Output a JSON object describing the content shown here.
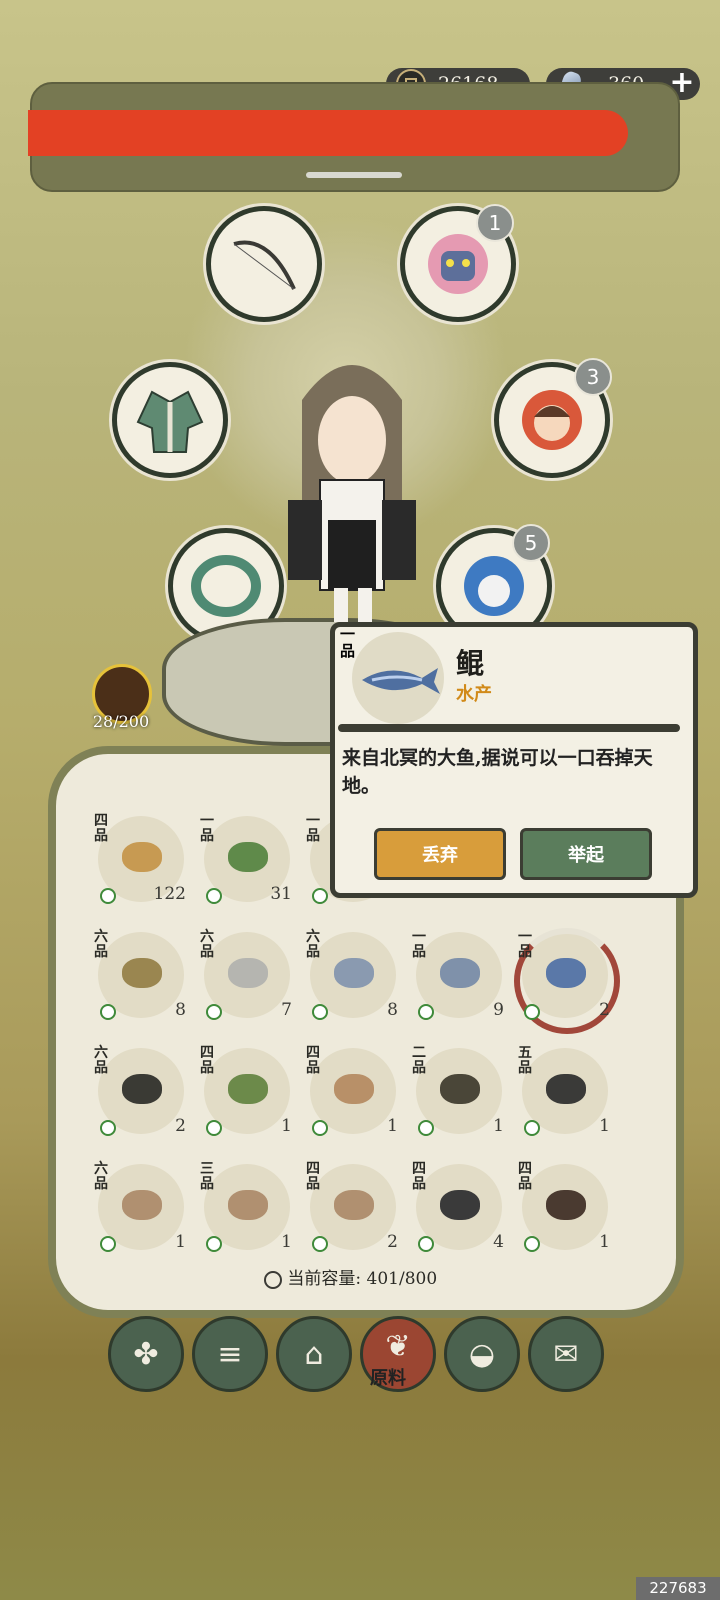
{
  "currency": {
    "coins": "26168",
    "gems": "360"
  },
  "equipment": {
    "slots": [
      {
        "name": "bow-icon"
      },
      {
        "name": "demon-mask-icon",
        "badge": "1"
      },
      {
        "name": "robe-icon"
      },
      {
        "name": "face-icon",
        "badge": "3"
      },
      {
        "name": "jade-ring-icon"
      },
      {
        "name": "spirit-icon",
        "badge": "5"
      }
    ]
  },
  "companion": {
    "count": "28/200"
  },
  "tooltip": {
    "grade": "一品",
    "name": "鲲",
    "category": "水产",
    "description": "来自北冥的大鱼,据说可以一口吞掉天地。",
    "discard_label": "丢弃",
    "lift_label": "举起"
  },
  "inventory": {
    "rows": [
      [
        {
          "g": "四品",
          "c": "122"
        },
        {
          "g": "一品",
          "c": "31"
        },
        {
          "g": "一品",
          "c": ""
        },
        {
          "g": "",
          "c": ""
        },
        {
          "g": "",
          "c": ""
        }
      ],
      [
        {
          "g": "六品",
          "c": "8"
        },
        {
          "g": "六品",
          "c": "7"
        },
        {
          "g": "六品",
          "c": "8"
        },
        {
          "g": "一品",
          "c": "9"
        },
        {
          "g": "一品",
          "c": "2"
        }
      ],
      [
        {
          "g": "六品",
          "c": "2"
        },
        {
          "g": "四品",
          "c": "1"
        },
        {
          "g": "四品",
          "c": "1"
        },
        {
          "g": "二品",
          "c": "1"
        },
        {
          "g": "五品",
          "c": "1"
        }
      ],
      [
        {
          "g": "六品",
          "c": "1"
        },
        {
          "g": "三品",
          "c": "1"
        },
        {
          "g": "四品",
          "c": "2"
        },
        {
          "g": "四品",
          "c": "4"
        },
        {
          "g": "四品",
          "c": "1"
        }
      ]
    ],
    "capacity_text": "当前容量: 401/800"
  },
  "nav": {
    "active_label": "原料"
  },
  "watermark": "227683"
}
